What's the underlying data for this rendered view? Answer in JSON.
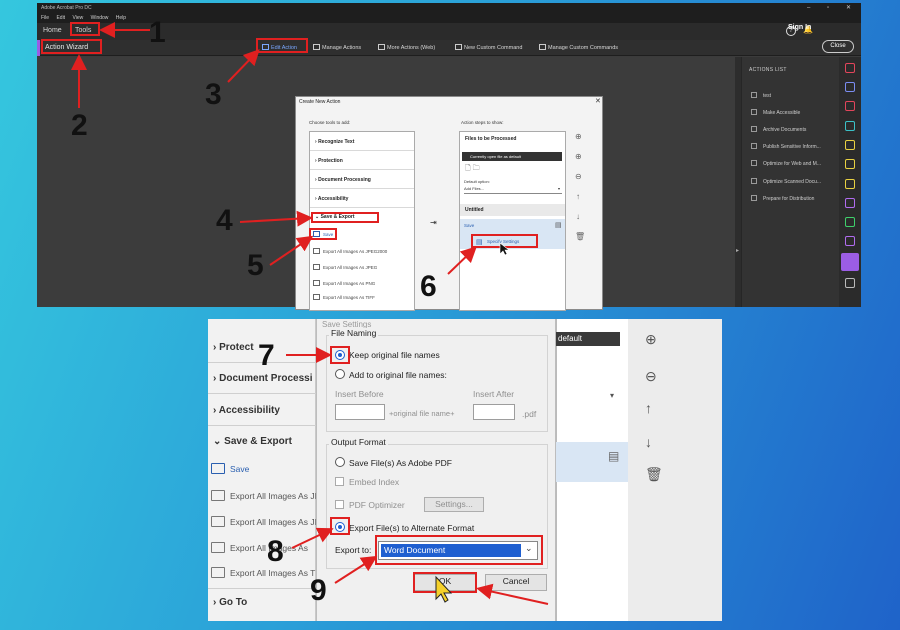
{
  "top": {
    "title_bar": "Adobe Acrobat Pro DC",
    "window_controls": [
      "–",
      "▫",
      "✕"
    ],
    "menu": [
      "File",
      "Edit",
      "View",
      "Window",
      "Help"
    ],
    "nav": {
      "home": "Home",
      "tools": "Tools",
      "sign_in": "Sign In",
      "help_glyph": "?",
      "bell_glyph": "🔔"
    },
    "toolbar": {
      "panel_title": "Action Wizard",
      "edit_action": "Edit Action",
      "manage_actions": "Manage Actions",
      "more_actions": "More Actions (Web)",
      "new_custom_command": "New Custom Command",
      "manage_custom_commands": "Manage Custom Commands",
      "close": "Close"
    },
    "actions_list": {
      "title": "ACTIONS LIST",
      "items": [
        "test",
        "Make Accessible",
        "Archive Documents",
        "Publish Sensitive Inform...",
        "Optimize for Web and M...",
        "Optimize Scanned Docu...",
        "Prepare for Distribution"
      ]
    },
    "dialog": {
      "title": "Create New Action",
      "close": "✕",
      "choose_tools": "Choose tools to add:",
      "tools": [
        "Recognize Text",
        "Protection",
        "Document Processing",
        "Accessibility",
        "Save & Export"
      ],
      "sub_items": [
        "Save",
        "Export All Images As JPEG2000",
        "Export All Images As JPEG",
        "Export All Images As PNG",
        "Export All Images As TIFF"
      ],
      "add_arrow": "⇥",
      "steps_label": "Action steps to show:",
      "files_head": "Files to be Processed",
      "current_file": "Currently open file as default",
      "default_option": "Default option:",
      "add_files": "Add Files...",
      "untitled": "Untitled",
      "save_step": "Save",
      "save_settings": "Specify Settings",
      "side_buttons": [
        "⊕",
        "⊕",
        "⊖",
        "↑",
        "↓",
        "🗑"
      ]
    }
  },
  "bottom": {
    "left_items": [
      "Protect",
      "Document Processi",
      "Accessibility",
      "Save & Export",
      "Go To"
    ],
    "left_sub": [
      "Save",
      "Export All Images As JI",
      "Export All Images As JI",
      "Export All Images As",
      "Export All Images As T"
    ],
    "top_label": "Save Settings",
    "file_naming": {
      "title": "File Naming",
      "keep_original": "Keep original file names",
      "add_to_original": "Add to original file names:",
      "insert_before": "Insert Before",
      "insert_after": "Insert After",
      "middle": "+original file name+",
      "ext": ".pdf"
    },
    "output_format": {
      "title": "Output Format",
      "save_as_pdf": "Save File(s) As Adobe PDF",
      "embed_index": "Embed Index",
      "pdf_optimizer": "PDF Optimizer",
      "settings": "Settings...",
      "export_alternate": "Export File(s) to Alternate Format",
      "export_to_label": "Export to:",
      "export_value": "Word Document"
    },
    "ok": "OK",
    "cancel": "Cancel",
    "right": {
      "default": "default",
      "icons": [
        "⊕",
        "⊖",
        "↑",
        "↓",
        "🗑"
      ],
      "dropdown_glyph": "▾",
      "list_glyph": "▤"
    }
  },
  "annotations": [
    "1",
    "2",
    "3",
    "4",
    "5",
    "6",
    "7",
    "8",
    "9"
  ],
  "colors": {
    "annotation": "#e02020",
    "accent": "#9b5de5",
    "selection": "#1f5fd0"
  }
}
